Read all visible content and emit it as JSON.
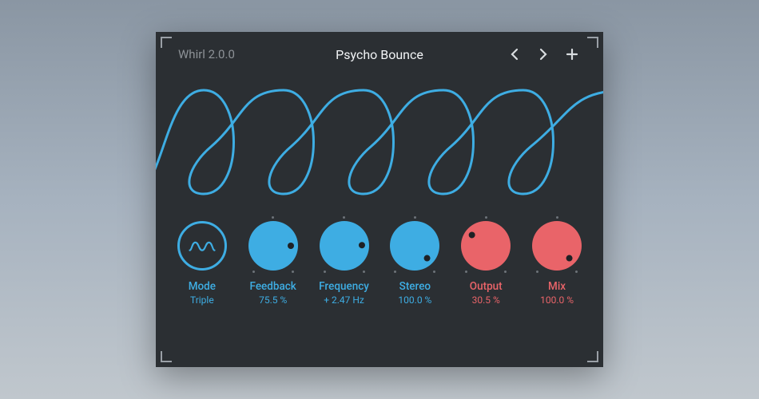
{
  "header": {
    "plugin_name": "Whirl 2.0.0",
    "preset_name": "Psycho Bounce"
  },
  "colors": {
    "blue": "#3eade3",
    "red": "#e96469",
    "panel": "#2b2f33"
  },
  "knobs": [
    {
      "id": "mode",
      "label": "Mode",
      "value": "Triple",
      "color": "blue",
      "style": "hollow",
      "percent": null
    },
    {
      "id": "feedback",
      "label": "Feedback",
      "value": "75.5 %",
      "color": "blue",
      "style": "filled",
      "percent": 75.5
    },
    {
      "id": "frequency",
      "label": "Frequency",
      "value": "+ 2.47 Hz",
      "color": "blue",
      "style": "filled",
      "percent": 75
    },
    {
      "id": "stereo",
      "label": "Stereo",
      "value": "100.0 %",
      "color": "blue",
      "style": "filled",
      "percent": 100
    },
    {
      "id": "output",
      "label": "Output",
      "value": "30.5 %",
      "color": "red",
      "style": "filled",
      "percent": 30.5
    },
    {
      "id": "mix",
      "label": "Mix",
      "value": "100.0 %",
      "color": "red",
      "style": "filled",
      "percent": 100
    }
  ]
}
